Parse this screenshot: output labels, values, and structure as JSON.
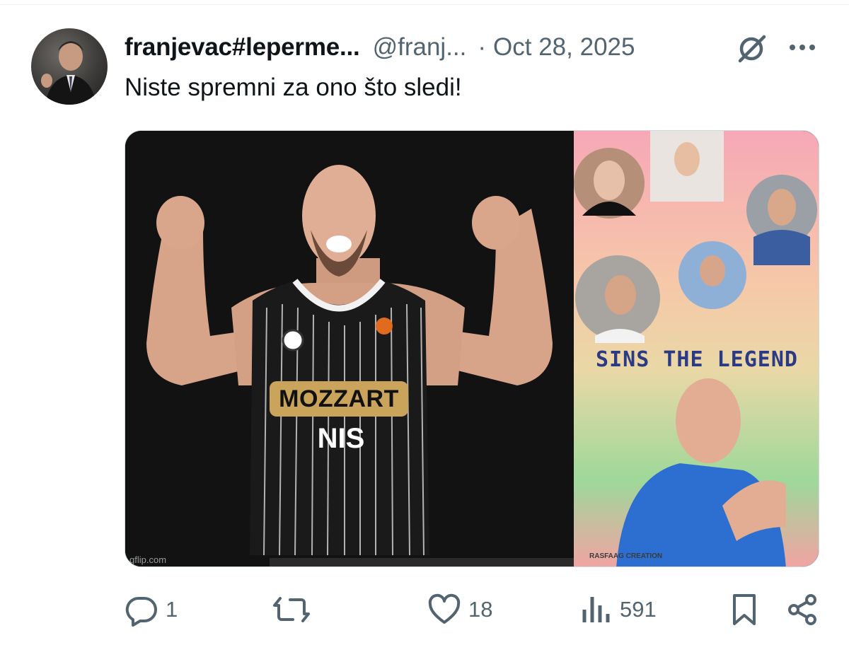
{
  "tweet": {
    "display_name": "franjevac#leperme...",
    "handle": "@franj...",
    "separator": "·",
    "date": "Oct 28, 2025",
    "text": "Niste spremni za ono što sledi!"
  },
  "media": {
    "left": {
      "jersey_sponsor": "MOZZART",
      "jersey_sponsor_2": "NIS",
      "watermark": "gflip.com"
    },
    "right": {
      "title": "SINS THE LEGEND",
      "credit": "RASFAAG CREATION"
    }
  },
  "actions": {
    "replies": "1",
    "reposts": "",
    "likes": "18",
    "views": "591"
  },
  "icons": {
    "grok": "grok-icon",
    "more": "more-icon",
    "reply": "reply-icon",
    "repost": "repost-icon",
    "like": "heart-icon",
    "views": "views-icon",
    "bookmark": "bookmark-icon",
    "share": "share-icon"
  },
  "colors": {
    "text": "#0f1419",
    "secondary": "#536471",
    "border": "#cfd9de",
    "legend": "#2a3a84"
  }
}
